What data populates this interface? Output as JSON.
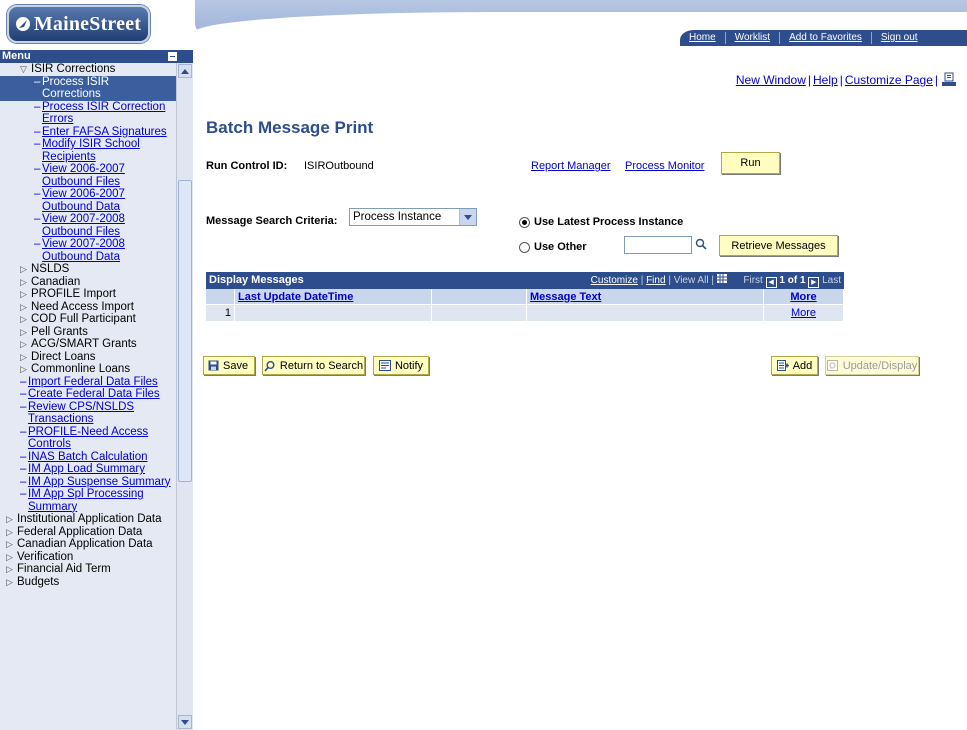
{
  "logo": {
    "text": "MaineStreet"
  },
  "header_tabs": [
    "Home",
    "Worklist",
    "Add to Favorites",
    "Sign out"
  ],
  "menu": {
    "title": "Menu",
    "items": [
      {
        "label": "ISIR Corrections",
        "level": 2,
        "type": "folder-open"
      },
      {
        "label": "Process ISIR Corrections",
        "level": 3,
        "type": "selected"
      },
      {
        "label": "Process ISIR Correction Errors",
        "level": 3,
        "type": "link"
      },
      {
        "label": "Enter FAFSA Signatures",
        "level": 3,
        "type": "link"
      },
      {
        "label": "Modify ISIR School Recipients",
        "level": 3,
        "type": "link"
      },
      {
        "label": "View 2006-2007 Outbound Files",
        "level": 3,
        "type": "link"
      },
      {
        "label": "View 2006-2007 Outbound Data",
        "level": 3,
        "type": "link"
      },
      {
        "label": "View 2007-2008 Outbound Files",
        "level": 3,
        "type": "link"
      },
      {
        "label": "View 2007-2008 Outbound Data",
        "level": 3,
        "type": "link"
      },
      {
        "label": "NSLDS",
        "level": 2,
        "type": "folder"
      },
      {
        "label": "Canadian",
        "level": 2,
        "type": "folder"
      },
      {
        "label": "PROFILE Import",
        "level": 2,
        "type": "folder"
      },
      {
        "label": "Need Access Import",
        "level": 2,
        "type": "folder"
      },
      {
        "label": "COD Full Participant",
        "level": 2,
        "type": "folder"
      },
      {
        "label": "Pell Grants",
        "level": 2,
        "type": "folder"
      },
      {
        "label": "ACG/SMART Grants",
        "level": 2,
        "type": "folder"
      },
      {
        "label": "Direct Loans",
        "level": 2,
        "type": "folder"
      },
      {
        "label": "Commonline Loans",
        "level": 2,
        "type": "folder"
      },
      {
        "label": "Import Federal Data Files",
        "level": 2,
        "type": "link"
      },
      {
        "label": "Create Federal Data Files",
        "level": 2,
        "type": "link"
      },
      {
        "label": "Review CPS/NSLDS Transactions",
        "level": 2,
        "type": "link"
      },
      {
        "label": "PROFILE-Need Access Controls",
        "level": 2,
        "type": "link"
      },
      {
        "label": "INAS Batch Calculation",
        "level": 2,
        "type": "link"
      },
      {
        "label": "IM App Load Summary",
        "level": 2,
        "type": "link"
      },
      {
        "label": "IM App Suspense Summary",
        "level": 2,
        "type": "link"
      },
      {
        "label": "IM App Spl Processing Summary",
        "level": 2,
        "type": "link"
      },
      {
        "label": "Institutional Application Data",
        "level": 1,
        "type": "folder"
      },
      {
        "label": "Federal Application Data",
        "level": 1,
        "type": "folder"
      },
      {
        "label": "Canadian Application Data",
        "level": 1,
        "type": "folder"
      },
      {
        "label": "Verification",
        "level": 1,
        "type": "folder"
      },
      {
        "label": "Financial Aid Term",
        "level": 1,
        "type": "folder"
      },
      {
        "label": "Budgets",
        "level": 1,
        "type": "folder"
      }
    ]
  },
  "toplinks": {
    "new_window": "New Window",
    "help": "Help",
    "customize": "Customize Page",
    "sep": "|"
  },
  "page": {
    "title": "Batch Message Print",
    "run_control_label": "Run Control ID:",
    "run_control_value": "ISIROutbound",
    "report_manager": "Report Manager",
    "process_monitor": "Process Monitor",
    "run_button": "Run",
    "search_criteria_label": "Message Search Criteria:",
    "search_criteria_value": "Process Instance",
    "radio_latest": "Use Latest Process Instance",
    "radio_other": "Use Other",
    "retrieve_button": "Retrieve Messages"
  },
  "grid": {
    "title": "Display Messages",
    "customize": "Customize",
    "find": "Find",
    "view_all": "View All",
    "first": "First",
    "range": "1 of 1",
    "last": "Last",
    "columns": [
      "Last Update DateTime",
      "Message Text",
      "More"
    ],
    "rows": [
      {
        "num": "1",
        "datetime": "",
        "text": "",
        "more": "More"
      }
    ]
  },
  "footer_buttons": {
    "save": "Save",
    "return": "Return to Search",
    "notify": "Notify",
    "add": "Add",
    "update": "Update/Display"
  }
}
